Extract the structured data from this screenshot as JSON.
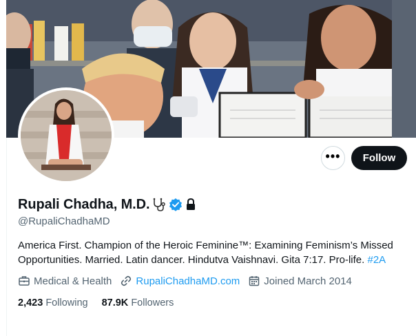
{
  "profile": {
    "display_name": "Rupali Chadha, M.D.",
    "name_emoji_icon": "stethoscope-icon",
    "verified_badge_icon": "verified-badge-icon",
    "protected_icon": "lock-icon",
    "handle": "@RupaliChadhaMD"
  },
  "bio": {
    "text": "America First. Champion of the Heroic Feminine™: Examining Feminism’s Missed Opportunities. Married. Latin dancer. Hindutva Vaishnavi. Gita 7:17. Pro-life. ",
    "hashtag": "#2A"
  },
  "meta": {
    "category": "Medical & Health",
    "website": "RupaliChadhaMD.com",
    "joined": "Joined March 2014"
  },
  "stats": {
    "following_count": "2,423",
    "following_label": "Following",
    "followers_count": "87.9K",
    "followers_label": "Followers"
  },
  "actions": {
    "more_label": "•••",
    "follow_label": "Follow"
  },
  "colors": {
    "accent": "#1d9bf0",
    "text_primary": "#0f1419",
    "text_secondary": "#536471",
    "border": "#cfd9de"
  }
}
